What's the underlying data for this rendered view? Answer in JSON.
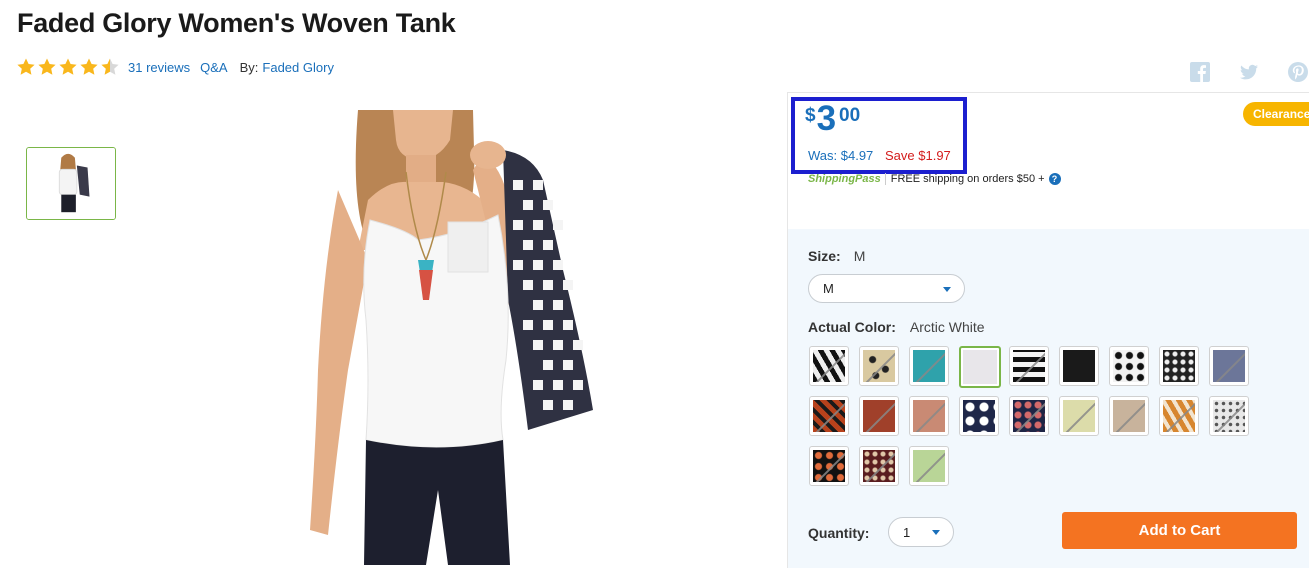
{
  "product": {
    "title": "Faded Glory Women's Woven Tank",
    "rating": 4.5,
    "reviews_label": "31 reviews",
    "qa_label": "Q&A",
    "by_label": "By:",
    "brand": "Faded Glory"
  },
  "social": [
    "facebook-icon",
    "twitter-icon",
    "pinterest-icon"
  ],
  "price": {
    "currency": "$",
    "dollars": "3",
    "cents": "00",
    "was": "Was: $4.97",
    "save": "Save $1.97",
    "badge": "Clearance"
  },
  "shipping": {
    "logo": "ShippingPass",
    "text": "FREE shipping on orders $50 +",
    "help": "?"
  },
  "size": {
    "label": "Size:",
    "value": "M",
    "selected": "M"
  },
  "color": {
    "label": "Actual Color:",
    "value": "Arctic White",
    "swatches": [
      {
        "style": "zebra",
        "available": false
      },
      {
        "style": "leopard",
        "available": false
      },
      {
        "style": "#2fa2ab",
        "available": false
      },
      {
        "style": "#e8e6ea",
        "available": true,
        "selected": true
      },
      {
        "style": "stripes",
        "available": false
      },
      {
        "style": "#1a1a1a",
        "available": true
      },
      {
        "style": "tile",
        "available": true
      },
      {
        "style": "paisley",
        "available": true
      },
      {
        "style": "#6c7699",
        "available": false
      },
      {
        "style": "tribal-rust",
        "available": false
      },
      {
        "style": "#a0402a",
        "available": false
      },
      {
        "style": "#c98a74",
        "available": false
      },
      {
        "style": "navy-floral",
        "available": true
      },
      {
        "style": "floral-dark",
        "available": false
      },
      {
        "style": "#dcdcaa",
        "available": false
      },
      {
        "style": "#c8b39c",
        "available": false
      },
      {
        "style": "tribal-orange",
        "available": false
      },
      {
        "style": "dots",
        "available": false
      },
      {
        "style": "floral-black",
        "available": false
      },
      {
        "style": "maroon-print",
        "available": false
      },
      {
        "style": "#b9d597",
        "available": false
      }
    ]
  },
  "quantity": {
    "label": "Quantity:",
    "value": "1"
  },
  "add_to_cart": "Add to Cart"
}
